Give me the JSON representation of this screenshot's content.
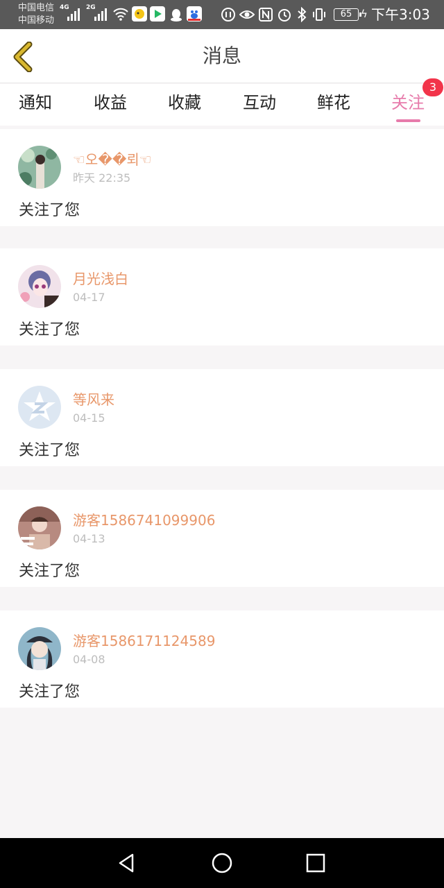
{
  "status_bar": {
    "carrier_1": "中国电信",
    "carrier_2": "中国移动",
    "net_1": "4G",
    "net_2": "2G",
    "battery": "65",
    "time": "下午3:03"
  },
  "header": {
    "title": "消息"
  },
  "tabs": [
    {
      "label": "通知"
    },
    {
      "label": "收益"
    },
    {
      "label": "收藏"
    },
    {
      "label": "互动"
    },
    {
      "label": "鲜花"
    },
    {
      "label": "关注",
      "active": true,
      "badge": "3"
    }
  ],
  "messages": [
    {
      "name": "☜오��뢰☜",
      "time": "昨天 22:35",
      "text": "关注了您"
    },
    {
      "name": "月光浅白",
      "time": "04-17",
      "text": "关注了您"
    },
    {
      "name": "等风来",
      "time": "04-15",
      "text": "关注了您"
    },
    {
      "name": "游客1586741099906",
      "time": "04-13",
      "text": "关注了您"
    },
    {
      "name": "游客1586171124589",
      "time": "04-08",
      "text": "关注了您"
    }
  ],
  "colors": {
    "accent": "#e77bab",
    "name": "#e8976a",
    "badge": "#f2344a",
    "back_arrow": "#d9b830"
  }
}
